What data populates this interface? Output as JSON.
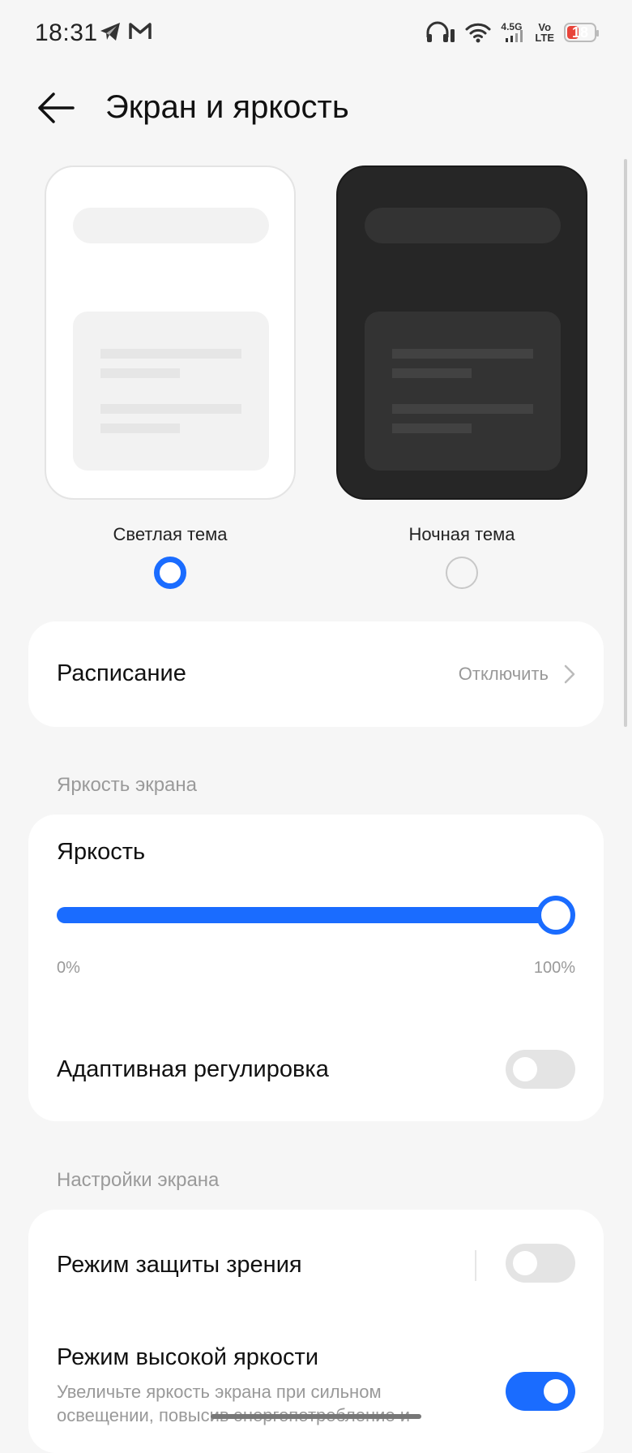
{
  "status_bar": {
    "time": "18:31",
    "network_top": "4.5G",
    "volte_top": "Vo",
    "volte_bottom": "LTE",
    "battery_level": "18",
    "icons": [
      "telegram-icon",
      "gmail-icon",
      "headphones-icon",
      "wifi-icon",
      "signal-icon",
      "battery-icon"
    ]
  },
  "header": {
    "title": "Экран и яркость",
    "back_icon": "arrow-left-icon"
  },
  "themes": {
    "light_label": "Светлая тема",
    "dark_label": "Ночная тема",
    "selected": "light"
  },
  "schedule": {
    "label": "Расписание",
    "value": "Отключить"
  },
  "brightness_section": {
    "header": "Яркость экрана",
    "brightness_label": "Яркость",
    "slider_value_percent": 100,
    "min_label": "0%",
    "max_label": "100%",
    "adaptive_label": "Адаптивная регулировка",
    "adaptive_enabled": false
  },
  "screen_section": {
    "header": "Настройки экрана",
    "eye_protection_label": "Режим защиты зрения",
    "eye_protection_enabled": false,
    "high_brightness_label": "Режим высокой яркости",
    "high_brightness_desc": "Увеличьте яркость экрана при сильном освещении, повысив энергопотребление и",
    "high_brightness_enabled": true
  },
  "colors": {
    "accent": "#1a6cff",
    "background": "#f6f6f6",
    "card": "#ffffff",
    "secondary_text": "#999999"
  }
}
